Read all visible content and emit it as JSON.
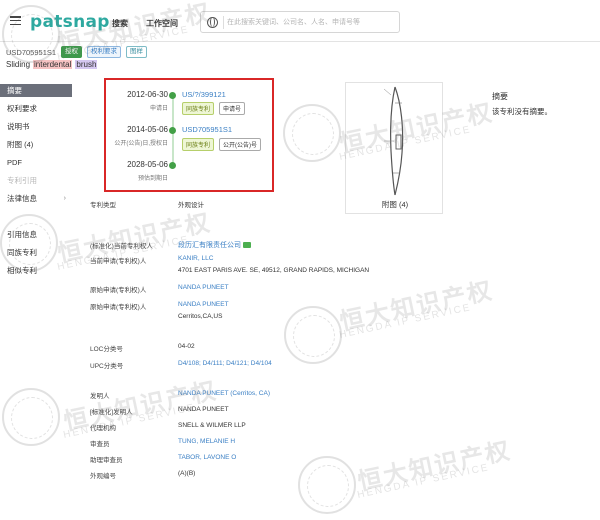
{
  "header": {
    "logo": "patsnap",
    "nav": [
      "搜索",
      "工作空间"
    ],
    "search_placeholder": "在此搜索关键词、公司名、人名、申请号等"
  },
  "patent": {
    "number": "USD705951S1",
    "badges": [
      "授权",
      "权利要求",
      "图样"
    ],
    "title_words": [
      "Sliding",
      "interdental",
      "brush"
    ]
  },
  "sidebar": {
    "items": [
      "摘要",
      "权利要求",
      "说明书",
      "附图 (4)",
      "PDF",
      "专利引用",
      "法律信息",
      "引用信息",
      "同族专利",
      "相似专利"
    ]
  },
  "timeline": {
    "events": [
      {
        "date": "2012-06-30",
        "desc": "申请日",
        "number": "US/?/399121",
        "tags": [
          "同族专利",
          "申请号"
        ]
      },
      {
        "date": "2014-05-06",
        "desc": "公开(公告)日,授权日",
        "number": "USD705951S1",
        "tags": [
          "同族专利",
          "公开(公告)号"
        ]
      },
      {
        "date": "2028-05-06",
        "desc": "预估到期日"
      }
    ]
  },
  "drawing": {
    "caption": "附图 (4)"
  },
  "abstract": {
    "title": "摘要",
    "text": "该专利没有摘要。"
  },
  "fields": [
    {
      "label": "专利类型",
      "value": "外观设计"
    },
    {
      "label": "(标准化)当前专利权人",
      "value": "段历汇有限责任公司",
      "link": true
    },
    {
      "label": "当前申请(专利权)人",
      "value": "KANIR, LLC"
    },
    {
      "label": "",
      "value": "4701 EAST PARIS AVE. SE, 49512, GRAND RAPIDS, MICHIGAN"
    },
    {
      "label": "原始申请(专利权)人",
      "value": "NANDA PUNEET",
      "link": true
    },
    {
      "label": "原始申请(专利权)人",
      "value": "NANDA PUNEET",
      "link": true
    },
    {
      "label": "",
      "value": "Cerritos,CA,US"
    },
    {
      "label": "LOC分类号",
      "value": "04-02"
    },
    {
      "label": "UPC分类号",
      "value": "D4/108; D4/111; D4/121; D4/104",
      "link": true
    },
    {
      "label": "发明人",
      "value": "NANDA PUNEET (Cerritos, CA)",
      "link": true
    },
    {
      "label": "[标准化]发明人",
      "value": "NANDA PUNEET"
    },
    {
      "label": "代理机构",
      "value": "SNELL & WILMER LLP"
    },
    {
      "label": "审查员",
      "value": "TUNG, MELANIE H",
      "link": true
    },
    {
      "label": "助理审查员",
      "value": "TABOR, LAVONE O",
      "link": true
    },
    {
      "label": "外观编号",
      "value": "(A)(B)"
    }
  ],
  "watermark": {
    "cn": "恒大知识产权",
    "en": "HENGDA IP SERVICE"
  }
}
